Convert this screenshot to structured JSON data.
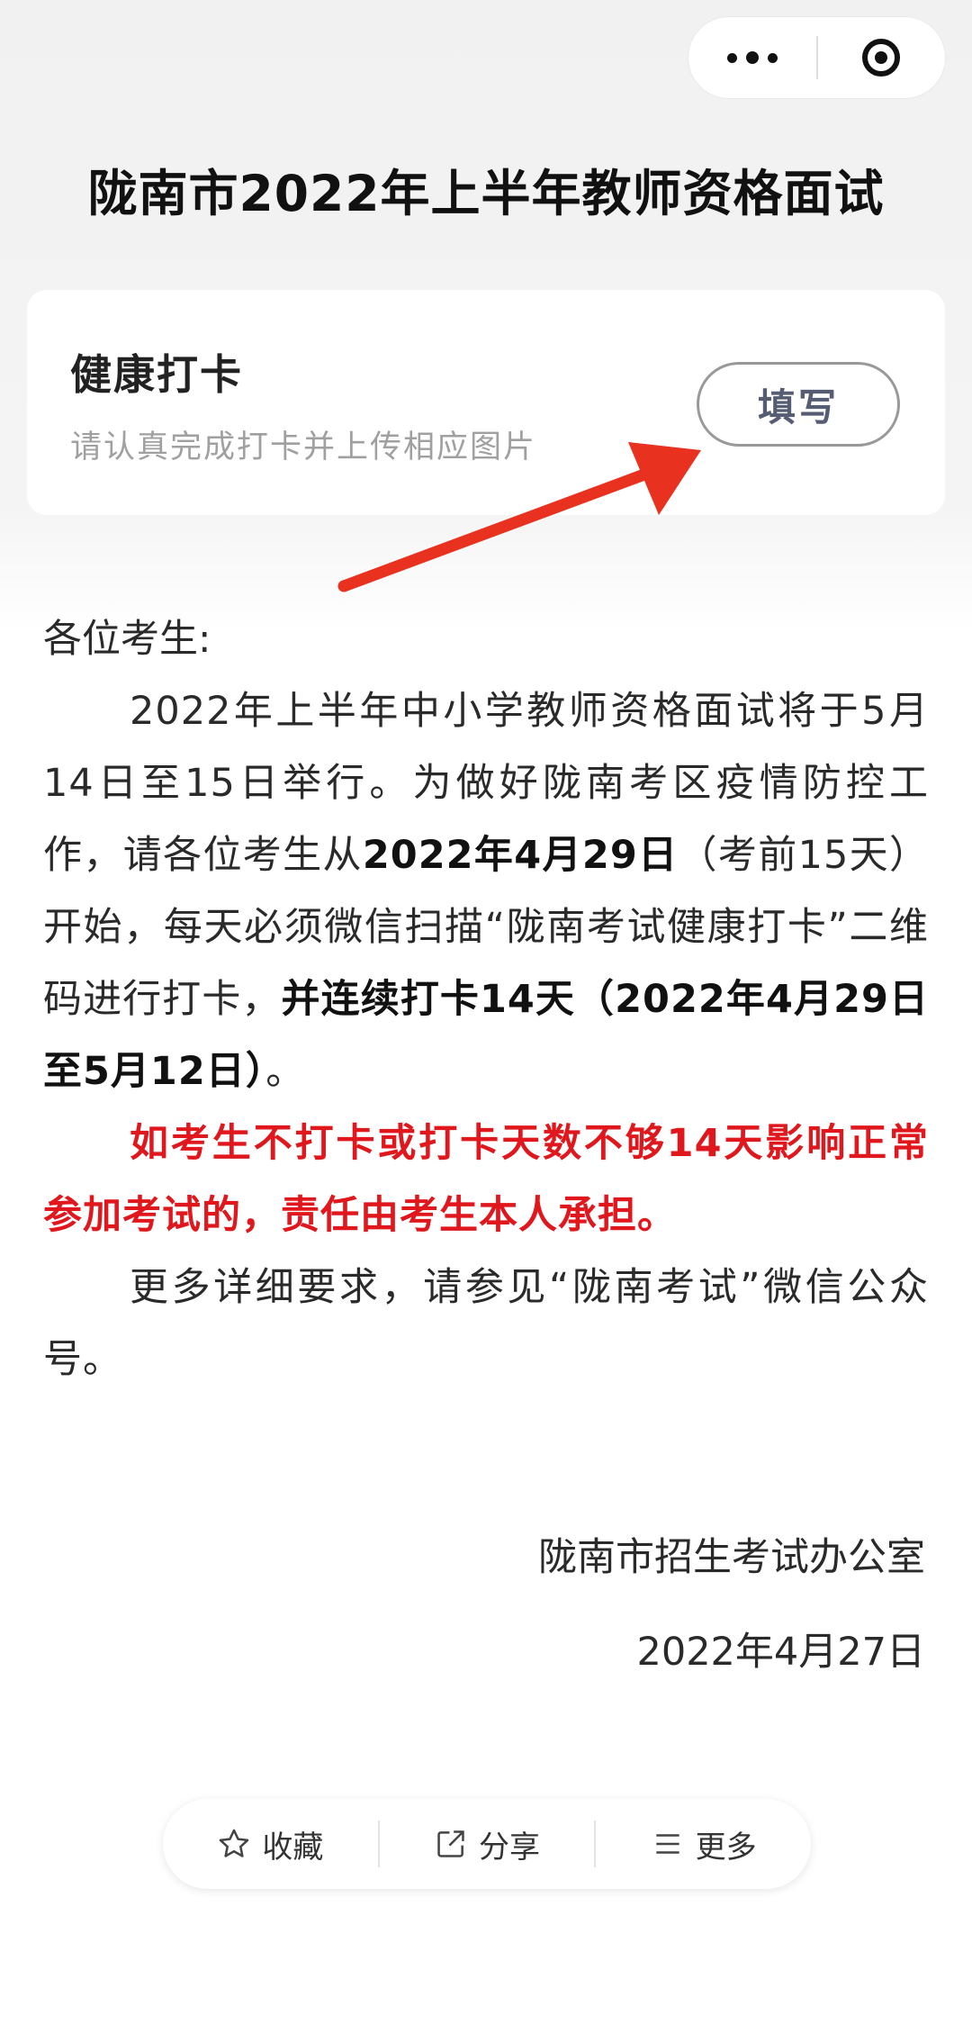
{
  "title": "陇南市2022年上半年教师资格面试",
  "card": {
    "title": "健康打卡",
    "subtitle": "请认真完成打卡并上传相应图片",
    "button": "填写"
  },
  "notice": {
    "greeting": "各位考生:",
    "p1": {
      "t1": "2022年上半年中小学教师资格面试将于5月14日至15日举行。为做好陇南考区疫情防控工作，请各位考生从",
      "b1": "2022年4月29日",
      "t2": "（考前15天）开始，每天必须微信扫描“陇南考试健康打卡”二维码进行打卡，",
      "b2": "并连续打卡14天（2022年4月29日至5月12日）",
      "t3": "。"
    },
    "p2": "如考生不打卡或打卡天数不够14天影响正常参加考试的，责任由考生本人承担。",
    "p3": "更多详细要求，请参见“陇南考试”微信公众号。",
    "signature": "陇南市招生考试办公室",
    "date": "2022年4月27日"
  },
  "bottom_bar": {
    "favorite": "收藏",
    "share": "分享",
    "more": "更多"
  },
  "colors": {
    "warning_text": "#e0171d",
    "arrow": "#e8321f",
    "button_text": "#565c72"
  },
  "icons": [
    "more-dots-icon",
    "close-target-icon",
    "arrow-annotation",
    "star-icon",
    "share-icon",
    "menu-icon"
  ]
}
